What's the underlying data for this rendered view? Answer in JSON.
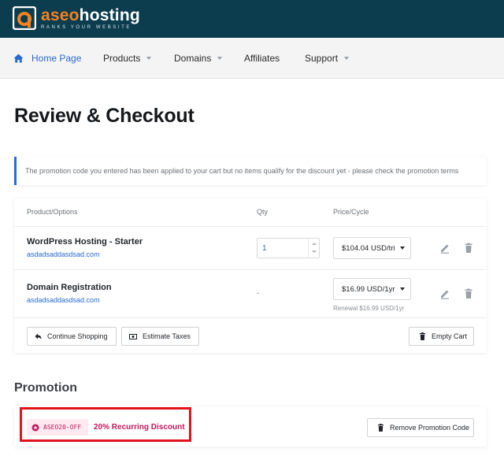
{
  "brand": {
    "name_part1": "aseo",
    "name_part2": "hosting",
    "tagline": "RANKS YOUR WEBSITE",
    "accent": "#f5821f",
    "header_bg": "#0c3d4f"
  },
  "nav": {
    "home": "Home Page",
    "products": "Products",
    "domains": "Domains",
    "affiliates": "Affiliates",
    "support": "Support",
    "active_color": "#2a6ad3"
  },
  "page": {
    "title": "Review & Checkout",
    "alert": "The promotion code you entered has been applied to your cart but no items qualify for the discount yet - please check the promotion terms"
  },
  "cart": {
    "headers": {
      "product": "Product/Options",
      "qty": "Qty",
      "price": "Price/Cycle"
    },
    "items": [
      {
        "name": "WordPress Hosting - Starter",
        "domain": "asdadsaddasdsad.com",
        "qty": "1",
        "price": "$104.04 USD/tri",
        "renewal": ""
      },
      {
        "name": "Domain Registration",
        "domain": "asdadsaddasdsad.com",
        "qty": "-",
        "price": "$16.99 USD/1yr",
        "renewal": "Renewal $16.99 USD/1yr"
      }
    ],
    "buttons": {
      "continue": "Continue Shopping",
      "estimate": "Estimate Taxes",
      "empty": "Empty Cart"
    }
  },
  "promotion": {
    "heading": "Promotion",
    "code": "ASEO20-OFF",
    "description": "20% Recurring Discount",
    "remove": "Remove Promotion Code",
    "color": "#c2185b",
    "highlight_color": "#e3131b"
  },
  "icons": {
    "home": "home-icon",
    "edit": "pencil-icon",
    "delete": "trash-icon",
    "back": "arrow-back-icon",
    "money": "money-icon",
    "tag": "tag-icon"
  }
}
